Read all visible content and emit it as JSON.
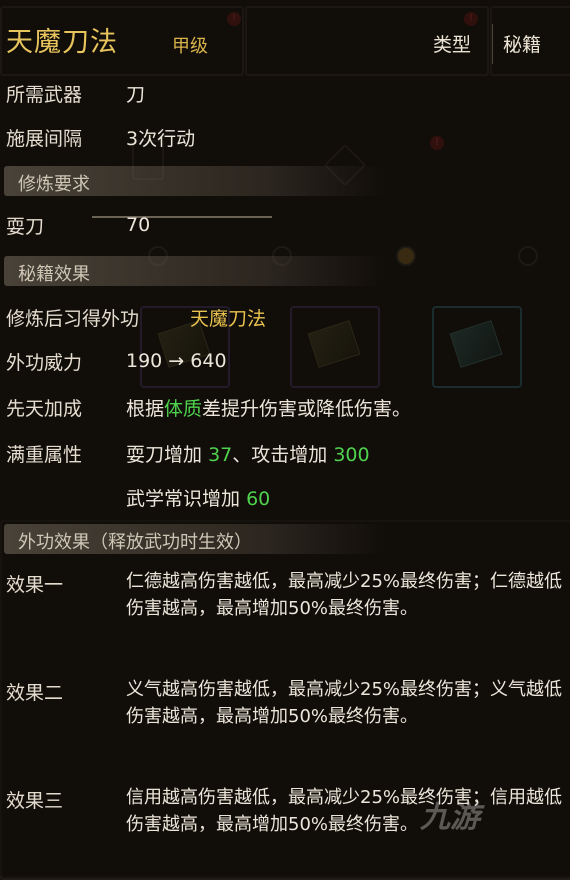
{
  "title": "天魔刀法",
  "grade": "甲级",
  "tabs": {
    "type": "类型",
    "secret": "秘籍"
  },
  "required_weapon": {
    "label": "所需武器",
    "value": "刀"
  },
  "interval": {
    "label": "施展间隔",
    "value": "3次行动"
  },
  "section_requirements": "修炼要求",
  "skill_req": {
    "label": "耍刀",
    "value": "70"
  },
  "section_effects": "秘籍效果",
  "learn": {
    "label": "修炼后习得外功",
    "value": "天魔刀法"
  },
  "power": {
    "label": "外功威力",
    "value": "190 → 640"
  },
  "innate": {
    "label": "先天加成",
    "prefix": "根据",
    "highlight": "体质",
    "suffix": "差提升伤害或降低伤害。"
  },
  "max_attr": {
    "label": "满重属性",
    "line1_a": "耍刀增加",
    "line1_a_val": "37",
    "line1_b": "、攻击增加",
    "line1_b_val": "300",
    "line2_a": "武学常识增加",
    "line2_a_val": "60"
  },
  "section_external": "外功效果（释放武功时生效）",
  "effects": [
    {
      "label": "效果一",
      "text": "仁德越高伤害越低，最高减少25%最终伤害；仁德越低伤害越高，最高增加50%最终伤害。"
    },
    {
      "label": "效果二",
      "text": "义气越高伤害越低，最高减少25%最终伤害；义气越低伤害越高，最高增加50%最终伤害。"
    },
    {
      "label": "效果三",
      "text": "信用越高伤害越低，最高减少25%最终伤害；信用越低伤害越高，最高增加50%最终伤害。"
    }
  ],
  "watermark": "九游"
}
